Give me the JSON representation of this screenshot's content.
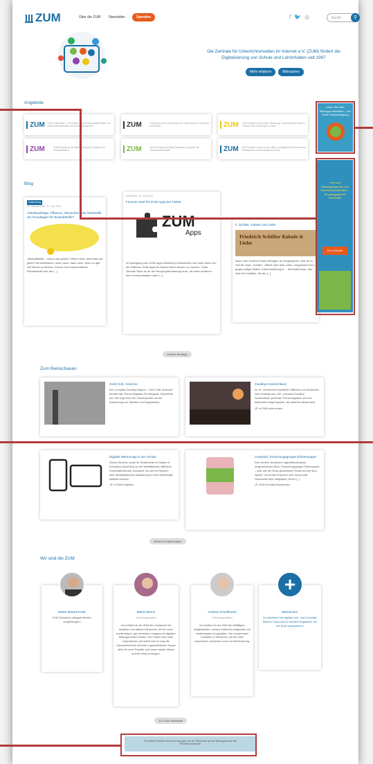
{
  "header": {
    "logo": "ZUM",
    "nav": [
      "Über die ZUM",
      "Newsletter"
    ],
    "spenden": "Spenden",
    "search_placeholder": "Suche"
  },
  "hero": {
    "text": "Die Zentrale für Unterrichtsmedien im Internet e.V. (ZUM) fördert die Digitalisierung von Schule und Lehrinhalten seit 1997",
    "btn_more": "Mehr erfahren",
    "btn_join": "Mitmachen"
  },
  "angebote": {
    "title": "Angebote",
    "items": [
      {
        "logo": "ZUM",
        "text": "ZUM-Unterrichten – eine offene, nicht kommerzielle Plattform für Unterrichtsmaterialien und Lehrerinformationen"
      },
      {
        "logo": "ZUM",
        "text": "ZUM-Apps ist ein Verzeichnis von Online-Apps für Unterricht und Schule"
      },
      {
        "logo": "ZUM",
        "text": "ZUM-Projekte ist ein Online-Werkzeug, um gemeinsam Texte zu erstellen oder Lehrinhalte zu teilen"
      },
      {
        "logo": "ZUM",
        "text": "ZUM-Projekte ist ein Wiki-Werkzeug für Projekte und Schulwebseiten"
      },
      {
        "logo": "ZUM",
        "text": "ZUM-Grundschule bietet Materialien, Angebote für Grundschullehrkräfte"
      },
      {
        "logo": "ZUM",
        "text": "ZUM Deutsch Lernen ist eine offene Lernplattform für Deutsch als Fremdsprache und Zweitsprache (DaZ)"
      }
    ]
  },
  "blog": {
    "title": "Blog",
    "more": "Weitere Beiträge",
    "posts": [
      {
        "badge": "Gastbeitrag",
        "meta": "Dr. Heinrich Graf, 22. Juni 2022",
        "title": "Arbeitsaufträge, Pflanzen, Menschen oder Reststoffe als Grundlagen für Biokraftstoffe?",
        "text": "„Biokraftstoffe – schon mal gehört? Wenn nicht, dann bitte auf jeden Fall weiterlesen, wenn doch, dann auch, denn es gibt viel Neues zu diesem Thema! Der fortschreitende Klimawandel und die [...]"
      },
      {
        "meta": "ZUMTeam, 10. Juni 2022",
        "title": "Funover Start für ZUM-Apps bei Twitter",
        "app": "ZUM",
        "app_sub": "Apps",
        "text": "Im Nachgang zum ZUM-Apps-Workshop entwickelten sich viele Ideen um die Plattform ZUM-Apps für Nutzer*innen besser zu machen. Unter Technik-Team ist an der Neuprogrammierung dran, die unter anderem eine Kommunikation unter [...]"
      },
      {
        "title": "F. Schiller: Kabale und Liebe",
        "book": "Friedrich Schiller Kabale & Liebe",
        "text": "Nach zwei Goethe-Faust-Vorträgen im vergangenen Jahr ist es Zeit für einen „Schiller“. Efficht oder freie Liebe, bürgerliche Ehre gegen adlige Willkür, Eheentwicklung in ... Wechselroman, das sind die Konflikte, die der [...]"
      }
    ]
  },
  "reinschauen": {
    "title": "Zum Reinschauen",
    "more": "Weitere Empfehlungen",
    "items": [
      {
        "title": "Grüß Gott, America!",
        "text": "Der „Lernpfad Goodbye Bayern – Grüß Gott, America!“ bereitet das Thema Migration für bilinguale Geschichte auf. Hier liegt einer der Schwerpunkte auf der Auswertung von Tabellen und Diagrammen.",
        "tag": "in ZUM-Unterrichten"
      },
      {
        "title": "Goodbye Deutschland",
        "text": "Im 19. Jahrhundert wanderten Millionen von Deutschen nach Amerika aus. Der „Lernpfad Goodbye Deutschland“ greift das Thema Migration auf und beleuchtet einige Aspekte, die weiterhin aktuell sind.",
        "tag": "in ZUM-Unterrichten"
      },
      {
        "title": "Digitale Werkzeuge in der Schule",
        "text": "Dieses Seminar wurde für Studierende im Master of Education (Gym/Ges) an der Westfälischen Wilhelms-Universität Münster konzipiert, die sich im Rahmen ihrer fachdidaktischen Ausbildung im Fach Mathematik befinden können.",
        "tag": "in ZUM-Projekten"
      },
      {
        "title": "Lesepfad „Forschungsgruppe Erbsensuppe“",
        "text": "Das mit dem deutschen Jugendliteraturpreis ausgezeichnete Buch „Forschungsgruppe Erbsensuppe – oder wie wir Omas gestohlenen Rosen auf die Spur kamen“ von Ruble Rowohl in eine humorvolle Geschichte über Integration, Recht [...]",
        "tag": "ZUM-Grundschulunterricht"
      }
    ]
  },
  "team": {
    "title": "Wir sind die ZUM",
    "more": "Zur ZUM-Teamseite",
    "members": [
      {
        "name": "Dieter Brand-Kruth",
        "role": "",
        "text": "ZUM Zahnische uitingute Modern empfehlungen!"
      },
      {
        "name": "Maria Sirsch",
        "role": "Gründungsmitglied",
        "text": "Ich schätze an der ZUM den Austausch mit kreativen und offenen Menschen, die für einen konstruktiven, gut vernetzten Umgang mit digitalen Bildungsmedien stehen. Die Treffen sind voller Inspirationen, die Arbeit und ich mag die Zusammenarbeit mit einer ungewöhnlichen Truppe offen für neue Projekte und immer wieder Neues auf den Weg zu bringen."
      },
      {
        "name": "Andrea Schellmann",
        "role": "Gründungsmitglied",
        "text": "Ich schätze an der ZUM die vielfältigen Möglichkeiten, meinen Unterricht zeitgemäß und medienbasiert zu gestalten. Die wunderbaren Kontakte zu Menschen, die die ZUM ausmachen, bereichern mich zur Bereicherung."
      },
      {
        "name": "Mitmachen",
        "role": "",
        "text": "Du möchtest freie digitale Lehr- und Lernmittel fördern? Dann bist Du herzlich eingeladen, bei der ZUM mitzumachen!",
        "plus": "+"
      }
    ]
  },
  "side_ads": {
    "top": "Unser Ziel aller Bildungsmaterialien – der ZUM Feierbeteiligung",
    "bottom": "Lern und Bildungsangebote und Unterrichtsmaterialien – für pädagogische Fachkräfte",
    "bottom_btn": "Zum Glossar"
  },
  "banner": {
    "text": "Für Dieter Entwürfe mit den Anregungen für die Teilnehmer auf der Bildungsmesse wer Pflichtenzusammen"
  },
  "social": [
    "f",
    "🐦",
    "◎"
  ],
  "colors": {
    "accent": "#1a6fa6",
    "annotation": "#b23a3a",
    "spenden": "#e85a1c"
  }
}
